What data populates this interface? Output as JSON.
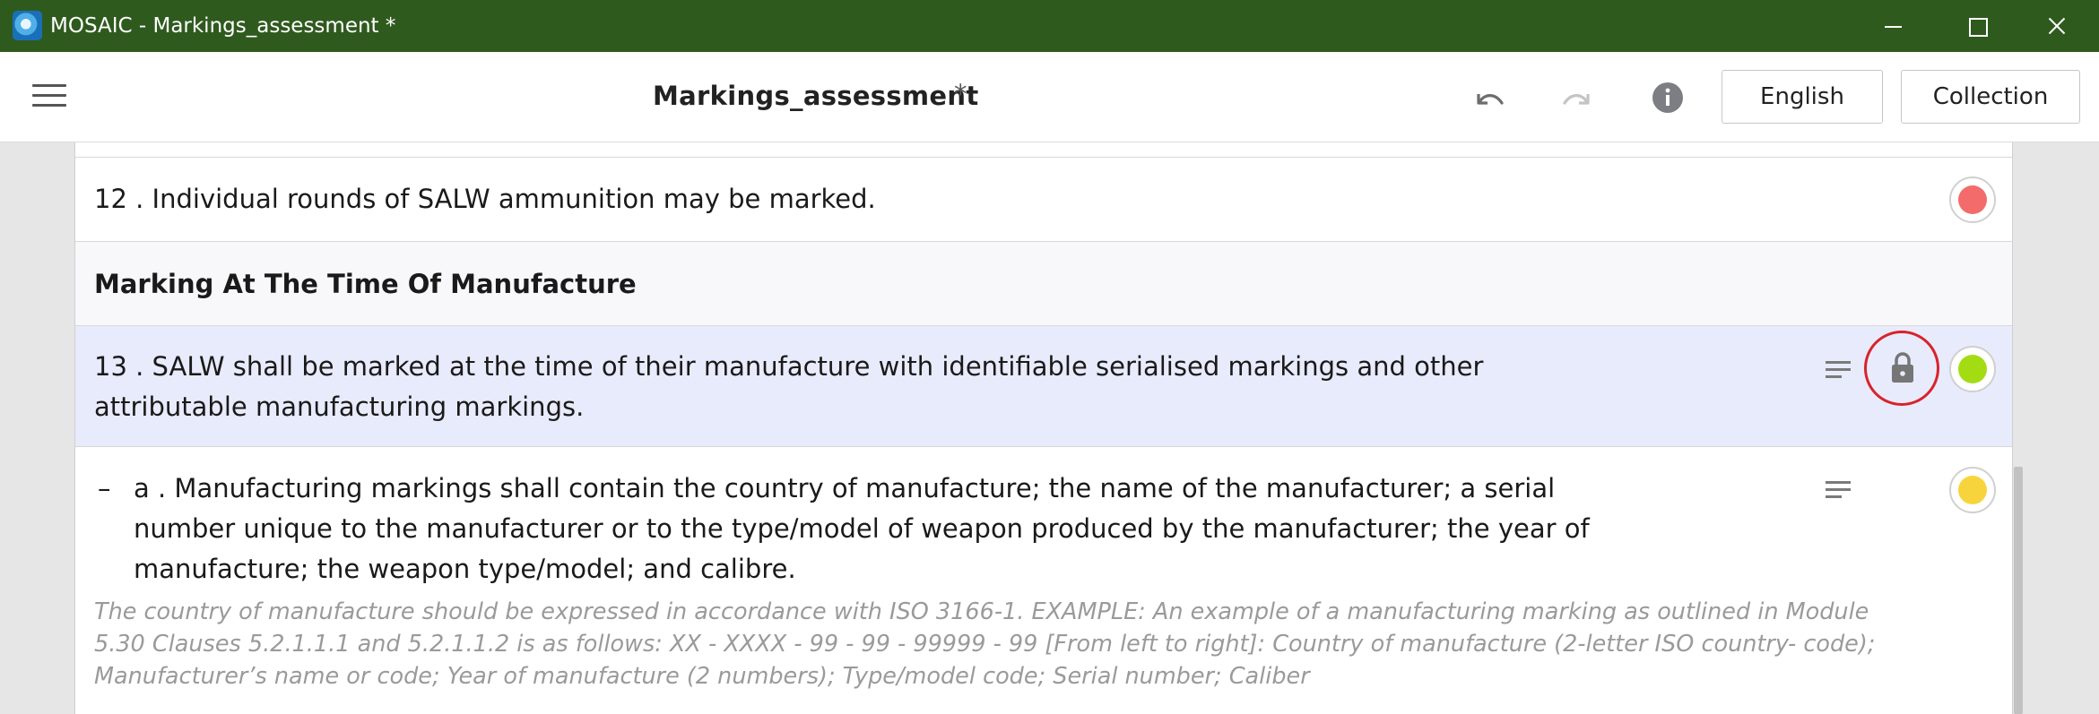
{
  "window": {
    "title": "MOSAIC - Markings_assessment *"
  },
  "header": {
    "document_title": "Markings_assessment",
    "dirty_marker": "*",
    "language_button": "English",
    "collection_button": "Collection"
  },
  "rows": [
    {
      "number": "12 .",
      "text": "12 .  Individual rounds of SALW ammunition may be marked.",
      "status_color": "#f46b6b"
    },
    {
      "section_title": "Marking At The Time Of Manufacture"
    },
    {
      "number": "13 .",
      "text": "13 .  SALW shall be marked at the time of their manufacture with identifiable serialised markings and other attributable manufacturing markings.",
      "status_color": "#a4dc14",
      "locked": true
    },
    {
      "number": "a .",
      "dash": "–",
      "text": "a .  Manufacturing markings shall contain the country of manufacture; the name of the manufacturer; a serial number unique to the manufacturer or to the type/model of weapon produced by the manufacturer; the year of manufacture; the weapon type/model; and calibre.",
      "guidance": "The country of manufacture should be expressed in accordance with ISO 3166-1. EXAMPLE: An example of a manufacturing marking as outlined in Module 5.30 Clauses 5.2.1.1.1 and 5.2.1.1.2 is as follows: XX - XXXX - 99 - 99 - 99999 - 99 [From left to right]: Country of manufacture (2-letter ISO country- code); Manufacturer’s name or code; Year of manufacture (2 numbers); Type/model code; Serial number; Caliber",
      "status_color": "#f8d43c"
    }
  ],
  "colors": {
    "titlebar": "#2f5a1e",
    "selected_row": "#e8ebfb",
    "lock_highlight": "#d8232a"
  },
  "icons": [
    "app-icon",
    "hamburger-menu-icon",
    "undo-icon",
    "redo-icon",
    "info-icon",
    "notes-icon",
    "lock-icon",
    "minimize-icon",
    "maximize-icon",
    "close-icon"
  ]
}
